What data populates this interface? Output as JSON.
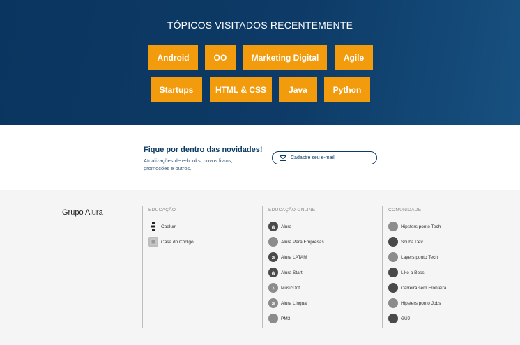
{
  "topics": {
    "title": "TÓPICOS VISITADOS RECENTEMENTE",
    "row1": [
      "Android",
      "OO",
      "Marketing Digital",
      "Agile"
    ],
    "row2": [
      "Startups",
      "HTML & CSS",
      "Java",
      "Python"
    ],
    "accent": "#f29b0c",
    "background": "#0d3a66"
  },
  "newsletter": {
    "title": "Fique por dentro das novidades!",
    "description": "Atualizações de e-books, novos livros, promoções e outros.",
    "button_label": "Cadastre seu e-mail",
    "button_icon": "mail-icon"
  },
  "footer": {
    "brand": "Grupo Alura",
    "educacao": {
      "title": "EDUCAÇÃO",
      "items": [
        {
          "label": "Caelum",
          "icon": "caelum-logo-icon",
          "glyph": ""
        },
        {
          "label": "Casa do Código",
          "icon": "casa-do-codigo-logo-icon",
          "glyph": ""
        }
      ]
    },
    "educacao_online": {
      "title": "EDUCAÇÃO ONLINE",
      "items": [
        {
          "label": "Alura",
          "icon": "alura-logo-icon",
          "glyph": "a"
        },
        {
          "label": "Alura Para Empresas",
          "icon": "alura-empresas-logo-icon",
          "glyph": ""
        },
        {
          "label": "Alura LATAM",
          "icon": "alura-latam-logo-icon",
          "glyph": "a"
        },
        {
          "label": "Alura Start",
          "icon": "alura-start-logo-icon",
          "glyph": "a"
        },
        {
          "label": "MusicDot",
          "icon": "musicdot-logo-icon",
          "glyph": "♪"
        },
        {
          "label": "Alura Língua",
          "icon": "alura-lingua-logo-icon",
          "glyph": "a"
        },
        {
          "label": "PM3",
          "icon": "pm3-logo-icon",
          "glyph": ""
        }
      ]
    },
    "comunidade": {
      "title": "COMUNIDADE",
      "items": [
        {
          "label": "Hipsters ponto Tech",
          "icon": "hipsters-tech-logo-icon",
          "glyph": ""
        },
        {
          "label": "Scuba Dev",
          "icon": "scuba-dev-logo-icon",
          "glyph": ""
        },
        {
          "label": "Layers ponto Tech",
          "icon": "layers-tech-logo-icon",
          "glyph": ""
        },
        {
          "label": "Like a Boss",
          "icon": "like-a-boss-logo-icon",
          "glyph": ""
        },
        {
          "label": "Carreira sem Fronteira",
          "icon": "carreira-sem-fronteira-logo-icon",
          "glyph": ""
        },
        {
          "label": "Hipsters ponto Jobs",
          "icon": "hipsters-jobs-logo-icon",
          "glyph": ""
        },
        {
          "label": "GUJ",
          "icon": "guj-logo-icon",
          "glyph": ""
        }
      ]
    }
  }
}
